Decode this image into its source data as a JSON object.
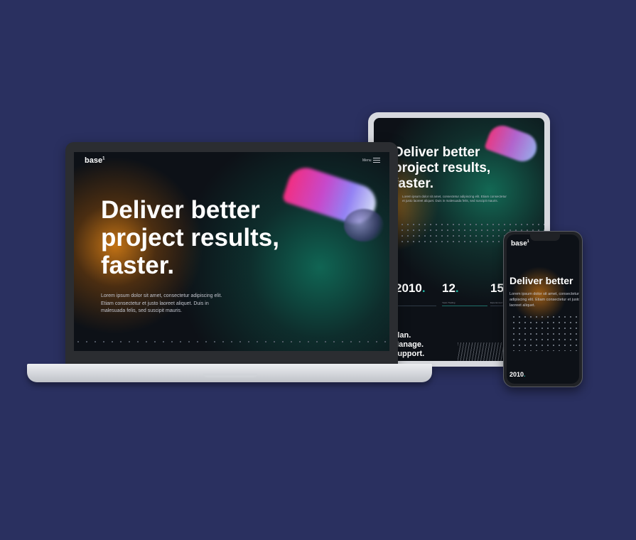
{
  "background_color": "#2a3060",
  "brand": {
    "logo_text": "base",
    "logo_mark": "1"
  },
  "laptop": {
    "menu_label": "Menu",
    "headline_line1": "Deliver better",
    "headline_line2": "project results,",
    "headline_line3": "faster.",
    "body_text": "Lorem ipsum dolor sit amet, consectetur adipiscing elit. Etiam consectetur et justo laoreet aliquet. Duis in malesuada felis, sed suscipit mauris."
  },
  "tablet": {
    "headline_line1": "Deliver better",
    "headline_line2": "project results,",
    "headline_line3": "faster.",
    "body_text": "Lorem ipsum dolor sit amet, consectetur adipiscing elit. Etiam consectetur et justo laoreet aliquet. Duis in malesuada felis, sed suscipit mauris.",
    "stats": [
      {
        "value": "2010",
        "label": ""
      },
      {
        "value": "12",
        "label": "Years Trading"
      },
      {
        "value": "15",
        "label": "Experienced Team"
      }
    ],
    "bottom_lines": [
      "Plan.",
      "Manage.",
      "Support."
    ]
  },
  "phone": {
    "headline": "Deliver better",
    "body_text": "Lorem ipsum dolor sit amet, consectetur adipiscing elit. Etiam consectetur et justo laoreet aliquet.",
    "stat": "2010"
  },
  "accent_colors": {
    "teal": "#24b0a0",
    "orange": "#cd7814",
    "pink": "#ff2f86"
  }
}
